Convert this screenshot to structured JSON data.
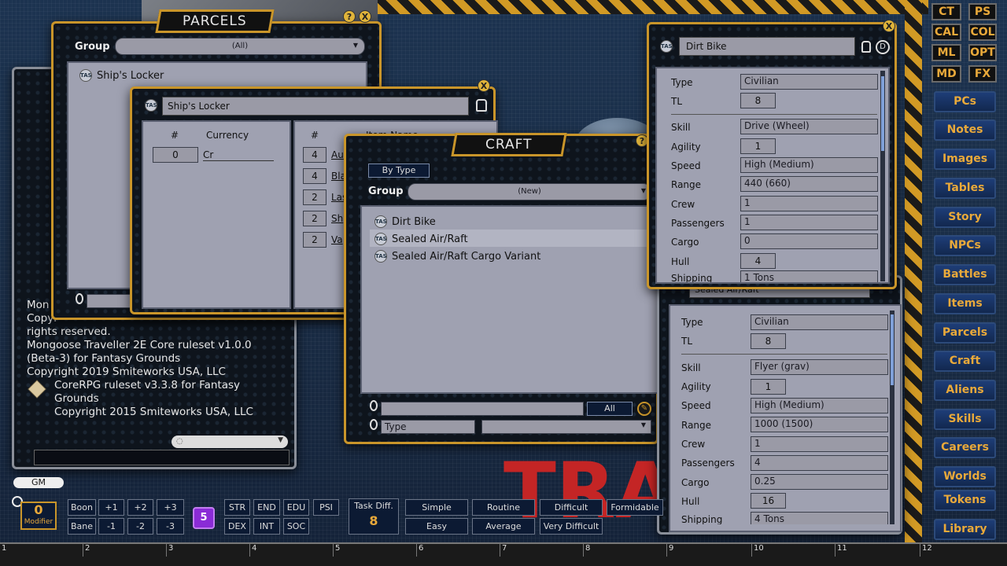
{
  "sidebar": {
    "top_buttons": [
      "CT",
      "PS",
      "CAL",
      "COL",
      "ML",
      "OPT",
      "MD",
      "FX"
    ],
    "items": [
      "PCs",
      "Notes",
      "Images",
      "Tables",
      "Story",
      "NPCs",
      "Battles",
      "Items",
      "Parcels",
      "Craft",
      "Aliens",
      "Skills",
      "Careers",
      "Worlds",
      "Tokens",
      "Library"
    ]
  },
  "about": {
    "lines": [
      "Mon",
      "Copyr",
      "rights reserved.",
      "Mongoose Traveller 2E Core ruleset v1.0.0",
      "(Beta-3) for Fantasy Grounds",
      "Copyright 2019 Smiteworks USA, LLC",
      "CoreRPG ruleset v3.3.8 for Fantasy",
      "Grounds",
      "Copyright 2015 Smiteworks USA, LLC"
    ]
  },
  "parcels": {
    "title": "PARCELS",
    "group_label": "Group",
    "group_value": "(All)",
    "items": [
      "Ship's Locker"
    ]
  },
  "locker": {
    "name": "Ship's Locker",
    "currency_headers": [
      "#",
      "Currency"
    ],
    "currency_rows": [
      {
        "qty": "0",
        "name": "Cr"
      }
    ],
    "item_headers": [
      "#",
      "Item Name"
    ],
    "item_qty": [
      "4",
      "4",
      "2",
      "2",
      "2"
    ],
    "item_names": [
      "Au",
      "Bla",
      "Las",
      "Sh",
      "Va"
    ]
  },
  "craft": {
    "title": "CRAFT",
    "by_type": "By Type",
    "group_label": "Group",
    "group_value": "(New)",
    "items": [
      "Dirt Bike",
      "Sealed Air/Raft",
      "Sealed Air/Raft Cargo Variant"
    ],
    "filter_all": "All",
    "type_label": "Type"
  },
  "dirt_bike": {
    "name": "Dirt Bike",
    "labels": [
      "Type",
      "TL",
      "Skill",
      "Agility",
      "Speed",
      "Range",
      "Crew",
      "Passengers",
      "Cargo",
      "Hull",
      "Shipping"
    ],
    "values": [
      "Civilian",
      "8",
      "Drive (Wheel)",
      "1",
      "High (Medium)",
      "440 (660)",
      "1",
      "1",
      "0",
      "4",
      "1 Tons"
    ]
  },
  "air_raft": {
    "name": "Sealed Air/Raft",
    "labels": [
      "Type",
      "TL",
      "Skill",
      "Agility",
      "Speed",
      "Range",
      "Crew",
      "Passengers",
      "Cargo",
      "Hull",
      "Shipping"
    ],
    "values": [
      "Civilian",
      "8",
      "Flyer (grav)",
      "1",
      "High (Medium)",
      "1000 (1500)",
      "1",
      "4",
      "0.25",
      "16",
      "4 Tons"
    ]
  },
  "bottom": {
    "gm": "GM",
    "modifier_value": "0",
    "modifier_label": "Modifier",
    "boon": "Boon",
    "bane": "Bane",
    "mods_top": [
      "+1",
      "+2",
      "+3"
    ],
    "mods_bottom": [
      "-1",
      "-2",
      "-3"
    ],
    "die": "5",
    "stats_top": [
      "STR",
      "END",
      "EDU",
      "PSI"
    ],
    "stats_bottom": [
      "DEX",
      "INT",
      "SOC"
    ],
    "task_label": "Task Diff.",
    "task_value": "8",
    "diff_top": [
      "Simple",
      "Routine",
      "Difficult",
      "Formidable"
    ],
    "diff_bottom": [
      "Easy",
      "Average",
      "Very Difficult"
    ],
    "hotkeys": [
      "1",
      "2",
      "3",
      "4",
      "5",
      "6",
      "7",
      "8",
      "9",
      "10",
      "11",
      "12"
    ]
  },
  "colors": {
    "gold": "#c9952a",
    "accent": "#e9a93a",
    "panel_bg": "#9fa1b1"
  }
}
